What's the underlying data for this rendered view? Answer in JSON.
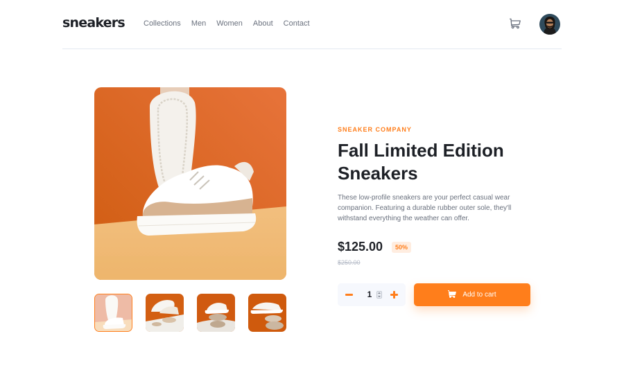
{
  "header": {
    "logo": "sneakers",
    "nav": [
      "Collections",
      "Men",
      "Women",
      "About",
      "Contact"
    ],
    "cart_icon": "cart-icon",
    "avatar_icon": "user-avatar"
  },
  "product": {
    "company": "SNEAKER COMPANY",
    "title": "Fall Limited Edition Sneakers",
    "description": "These low-profile sneakers are your perfect casual wear companion. Featuring a durable rubber outer sole, they'll withstand everything the weather can offer.",
    "price": "$125.00",
    "discount": "50%",
    "original_price": "$250.00"
  },
  "gallery": {
    "active_thumbnail": 1,
    "thumbnail_count": 4
  },
  "cart_controls": {
    "quantity": "1",
    "add_label": "Add to cart",
    "minus_icon": "minus-icon",
    "plus_icon": "plus-icon"
  },
  "colors": {
    "accent": "#ff7e1b",
    "accent_pale": "#ffede0",
    "text_dark": "#1d2026",
    "text_gray": "#69707d",
    "text_light": "#b6bcc8",
    "qty_bg": "#f6f8fd"
  }
}
